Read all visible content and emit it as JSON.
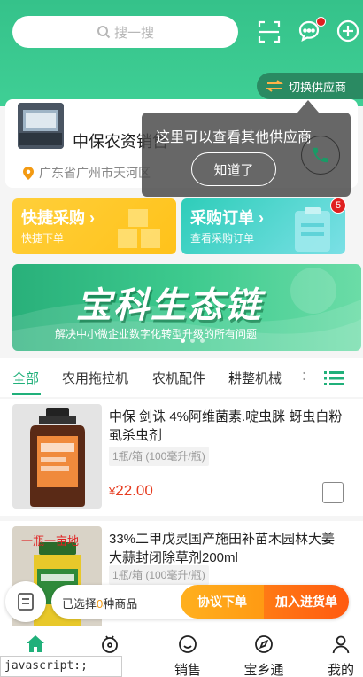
{
  "header": {
    "search_placeholder": "搜一搜",
    "switch_supplier_label": "切换供应商",
    "colors": {
      "brand_green": "#35c28a",
      "badge_red": "#e02020"
    },
    "icons": [
      "search-icon",
      "scan-icon",
      "message-icon",
      "add-icon",
      "swap-icon"
    ]
  },
  "supplier": {
    "name": "中保农资销售",
    "address": "广东省广州市天河区"
  },
  "tooltip": {
    "text": "这里可以查看其他供应商",
    "ok_label": "知道了"
  },
  "quick": {
    "purchase_title": "快捷采购",
    "purchase_sub": "快捷下单",
    "orders_title": "采购订单",
    "orders_sub": "查看采购订单",
    "orders_badge": "5"
  },
  "banner": {
    "title": "宝科生态链",
    "subtitle": "解决中小微企业数字化转型升级的所有问题",
    "active_slide": 1,
    "slide_count": 3
  },
  "tabs": {
    "items": [
      "全部",
      "农用拖拉机",
      "农机配件",
      "耕整机械"
    ],
    "more": "：",
    "active": 0
  },
  "products": [
    {
      "title": "中保 剑诛 4%阿维菌素.啶虫脒 蚜虫白粉虱杀虫剂",
      "spec": "1瓶/箱 (100毫升/瓶)",
      "currency": "¥",
      "price": "22.00"
    },
    {
      "title": "33%二甲戊灵国产施田补苗木园林大姜大蒜封闭除草剂200ml",
      "spec": "1瓶/箱 (100毫升/瓶)",
      "image_text": "一瓶一亩地"
    }
  ],
  "action_bar": {
    "selected_prefix": "已选择",
    "selected_count": "0",
    "selected_suffix": "种商品",
    "protocol_order": "协议下单",
    "add_to_cart": "加入进货单"
  },
  "tabbar": {
    "items": [
      "首页",
      "订单",
      "销售",
      "宝乡通",
      "我的"
    ]
  },
  "status_bar": "javascript:;"
}
